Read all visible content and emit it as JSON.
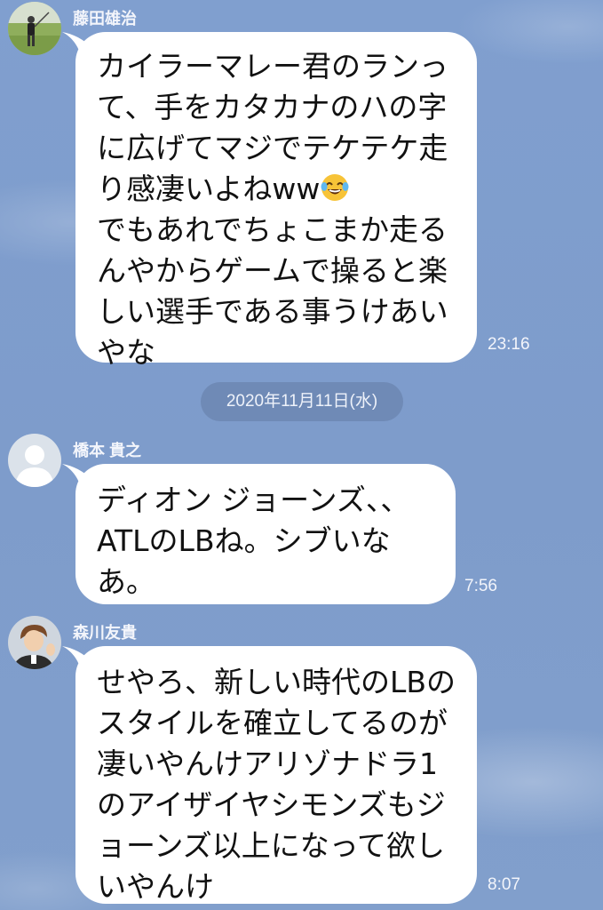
{
  "messages": [
    {
      "sender": "藤田雄治",
      "text_before_emoji": "カイラーマレー君のランって、手をカタカナのハの字に広げてマジでテケテケ走り感凄いよねww",
      "emoji": "face-with-tears-of-joy",
      "text_after_emoji": "でもあれでちょこまか走るんやからゲームで操ると楽しい選手である事うけあいやな",
      "time": "23:16"
    },
    {
      "sender": "橋本 貴之",
      "text": "ディオン ジョーンズ、、ATLのLBね。シブいなあ。",
      "time": "7:56"
    },
    {
      "sender": "森川友貴",
      "text": "せやろ、新しい時代のLBのスタイルを確立してるのが凄いやんけアリゾナドラ1のアイザイヤシモンズもジョーンズ以上になって欲しいやんけ",
      "time": "8:07"
    }
  ],
  "date_separator": "2020年11月11日(水)",
  "colors": {
    "background": "#7f9dcb",
    "bubble": "#ffffff",
    "date_pill": "#6f8ab6"
  }
}
